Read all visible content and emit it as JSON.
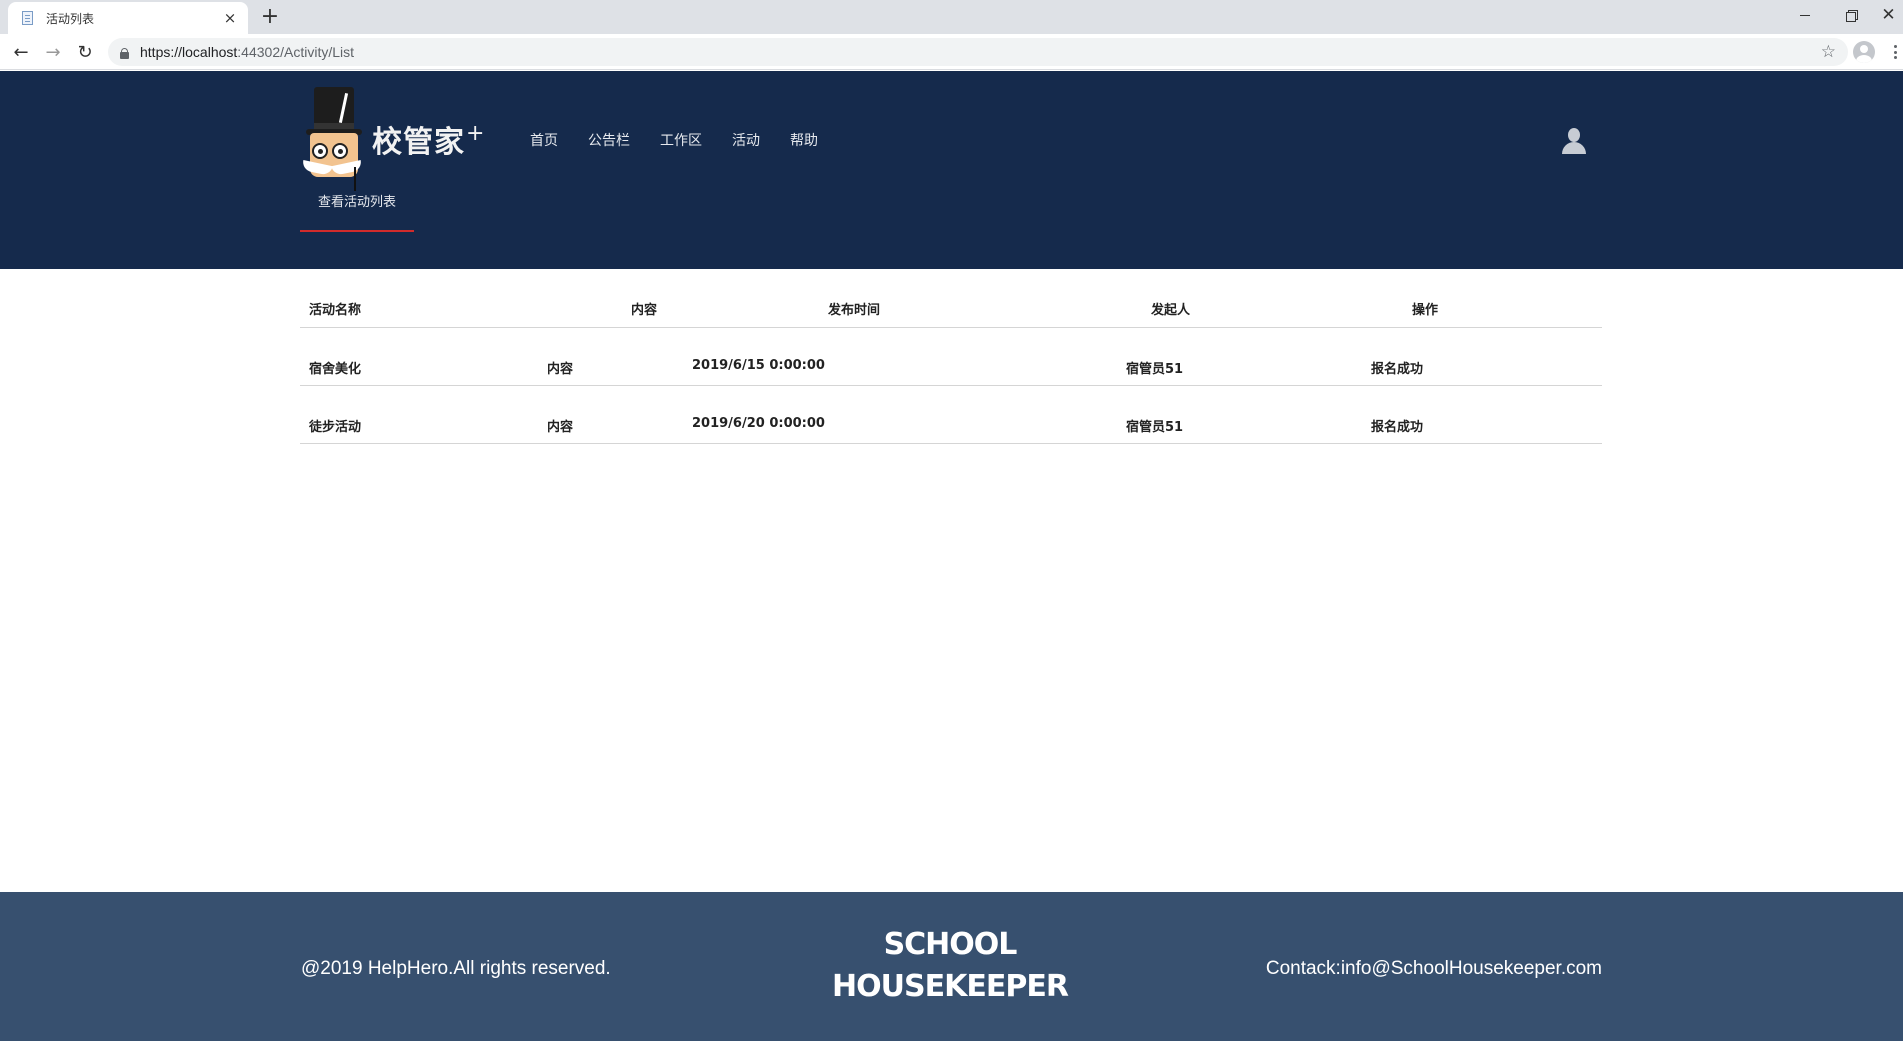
{
  "browser": {
    "tab_title": "活动列表",
    "tab_close": "×",
    "new_tab": "+",
    "url_host": "https://localhost",
    "url_rest": ":44302/Activity/List",
    "back_icon": "←",
    "forward_icon": "→",
    "reload_icon": "↻",
    "star_icon": "☆",
    "close_icon": "✕"
  },
  "header": {
    "logo_text": "校管家",
    "logo_sup": "+",
    "nav": [
      "首页",
      "公告栏",
      "工作区",
      "活动",
      "帮助"
    ],
    "sub_tab": "查看活动列表",
    "colors": {
      "background": "#152a4c",
      "active_underline": "#d12b2b"
    }
  },
  "table": {
    "headers": [
      "活动名称",
      "内容",
      "发布时间",
      "发起人",
      "操作"
    ],
    "rows": [
      [
        "宿舍美化",
        "内容",
        "2019/6/15 0:00:00",
        "宿管员51",
        "报名成功"
      ],
      [
        "徒步活动",
        "内容",
        "2019/6/20 0:00:00",
        "宿管员51",
        "报名成功"
      ]
    ]
  },
  "footer": {
    "copyright": "@2019 HelpHero.All rights reserved.",
    "brand_line1": "SCHOOL",
    "brand_line2": "HOUSEKEEPER",
    "contact": "Contack:info@SchoolHousekeeper.com",
    "background": "#37506f"
  }
}
